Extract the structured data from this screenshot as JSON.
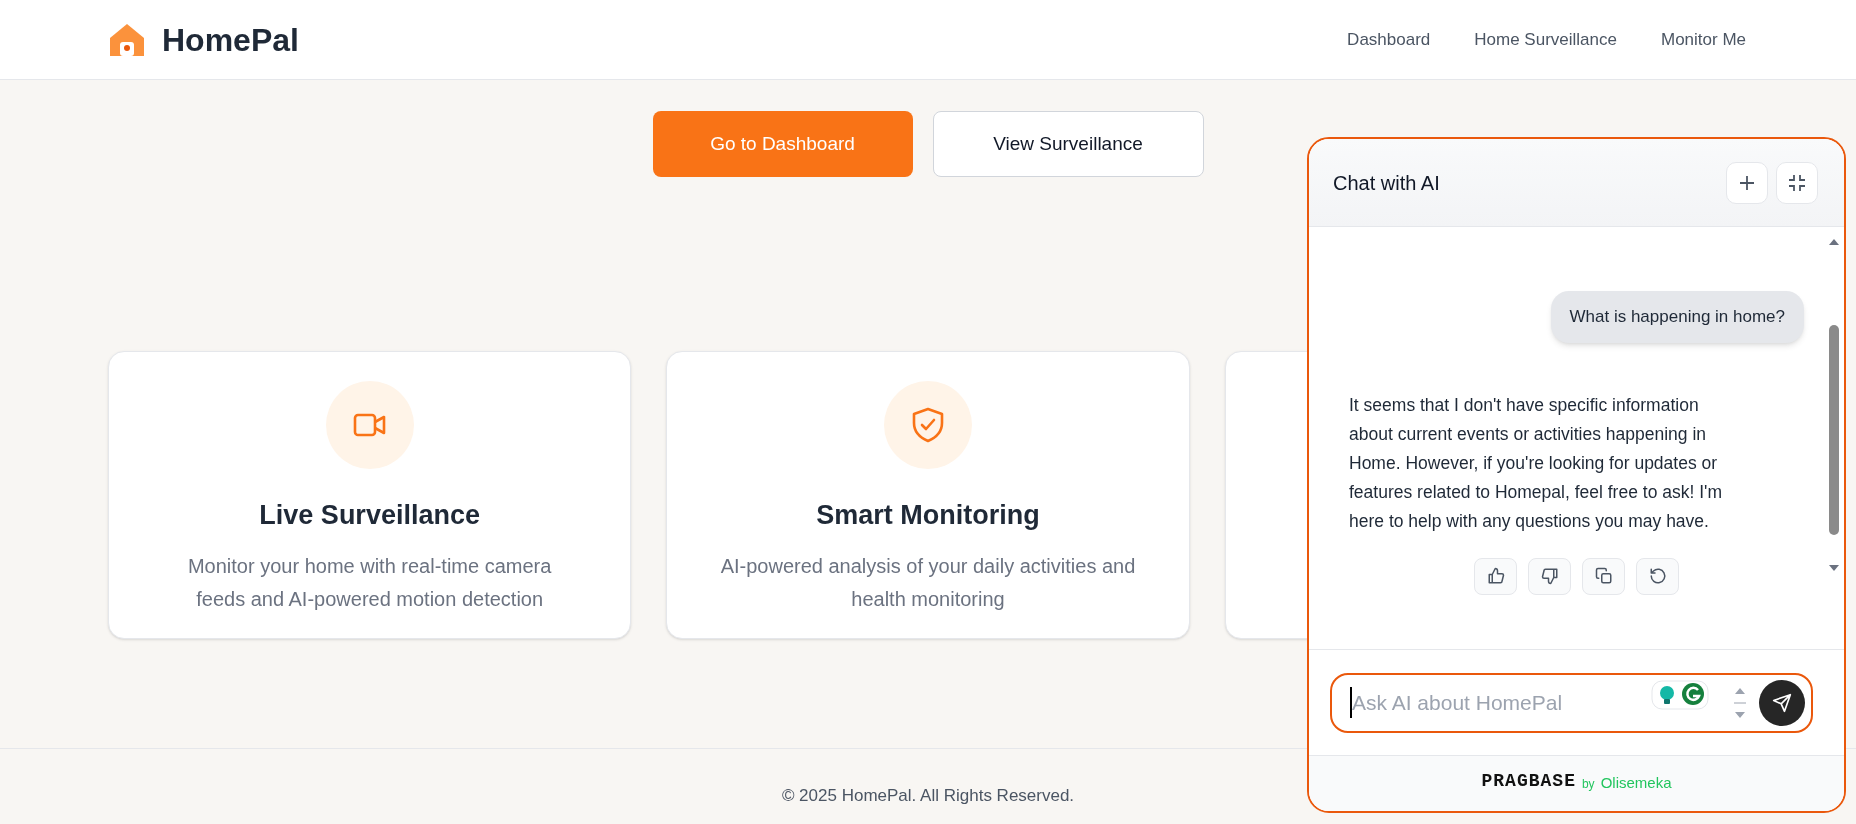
{
  "header": {
    "brand": "HomePal",
    "nav": [
      {
        "label": "Dashboard"
      },
      {
        "label": "Home Surveillance"
      },
      {
        "label": "Monitor Me"
      }
    ]
  },
  "hero_buttons": [
    {
      "label": "Go to Dashboard",
      "kind": "primary"
    },
    {
      "label": "View Surveillance",
      "kind": "secondary"
    }
  ],
  "features": [
    {
      "kind": "video",
      "title": "Live Surveillance",
      "description": "Monitor your home with real-time camera feeds and AI-powered motion detection"
    },
    {
      "kind": "shield",
      "title": "Smart Monitoring",
      "description": "AI-powered analysis of your daily activities and health monitoring"
    },
    {
      "kind": "covered"
    }
  ],
  "footer": {
    "copyright": "© 2025 HomePal. All Rights Reserved."
  },
  "chat": {
    "title": "Chat with AI",
    "messages": [
      {
        "kind": "user",
        "text": "What is happening in home?"
      },
      {
        "kind": "assistant",
        "text": "It seems that I don't have specific information about current events or activities happening in Home. However, if you're looking for updates or features related to Homepal, feel free to ask! I'm here to help with any questions you may have."
      }
    ],
    "input": {
      "placeholder": "Ask AI about HomePal"
    },
    "brand": "PRAGBASE",
    "brand_by": "by",
    "brand_author": "Olisemeka"
  }
}
